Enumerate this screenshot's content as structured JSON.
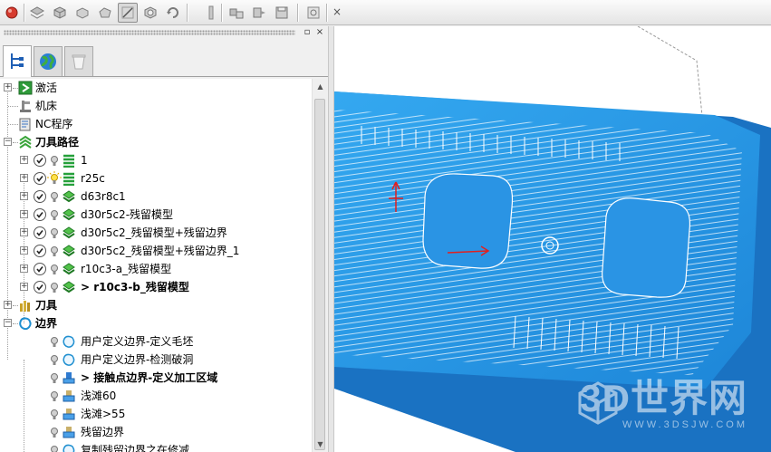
{
  "toolbar": {
    "buttons": [
      "record-icon",
      "layer-icon",
      "model-icon",
      "block-icon",
      "boundary-icon",
      "select-icon",
      "cube-icon",
      "rotate-icon",
      "separator-icon",
      "pattern-icon",
      "stock-icon",
      "save-icon",
      "info-icon"
    ],
    "close_label": "×"
  },
  "panel": {
    "float_label": "▫",
    "close_label": "×",
    "tabs": [
      "explorer-tree-tab",
      "globe-tab",
      "recycle-bin-tab"
    ]
  },
  "tree": {
    "items": [
      {
        "label": "激活",
        "bold": false
      },
      {
        "label": "机床",
        "bold": false
      },
      {
        "label": "NC程序",
        "bold": false
      },
      {
        "label": "刀具路径",
        "bold": true
      },
      {
        "label": "1",
        "bold": false
      },
      {
        "label": "r25c",
        "bold": false
      },
      {
        "label": "d63r8c1",
        "bold": false
      },
      {
        "label": "d30r5c2-残留模型",
        "bold": false
      },
      {
        "label": "d30r5c2_残留模型+残留边界",
        "bold": false
      },
      {
        "label": "d30r5c2_残留模型+残留边界_1",
        "bold": false
      },
      {
        "label": "r10c3-a_残留模型",
        "bold": false
      },
      {
        "label": "> r10c3-b_残留模型",
        "bold": true
      },
      {
        "label": "刀具",
        "bold": true
      },
      {
        "label": "边界",
        "bold": true
      },
      {
        "label": "用户定义边界-定义毛坯",
        "bold": false
      },
      {
        "label": "用户定义边界-检测破洞",
        "bold": false
      },
      {
        "label": "> 接触点边界-定义加工区域",
        "bold": true
      },
      {
        "label": "浅滩60",
        "bold": false
      },
      {
        "label": "浅滩>55",
        "bold": false
      },
      {
        "label": "残留边界",
        "bold": false
      },
      {
        "label": "复制残留边界之在修减",
        "bold": false
      }
    ]
  },
  "scrollbar": {
    "up": "▲",
    "down": "▼"
  },
  "watermark": {
    "brand": "3D世界网",
    "url": "WWW.3DSJW.COM"
  },
  "colors": {
    "model_blue": "#2196e8",
    "model_dark": "#1a6fb8",
    "toolpath_white": "#ffffff",
    "axis_red": "#e02020"
  }
}
